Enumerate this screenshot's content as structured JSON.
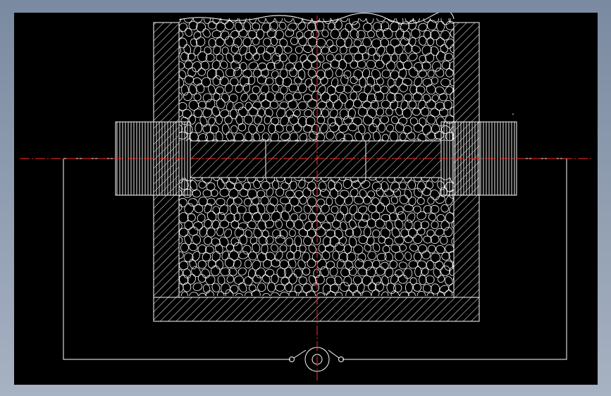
{
  "window": {
    "background_frame_color": "#8a97aa",
    "canvas_color": "#000000"
  },
  "drawing": {
    "type": "CAD cross-section: electrode cell with porous packing and circuit",
    "colors": {
      "line": "#ffffff",
      "center_line": "#ff2a2a"
    },
    "components": [
      "container-wall-left",
      "container-wall-right",
      "container-bottom",
      "porous-bed-upper",
      "porous-bed-lower",
      "electrode-rod",
      "terminal-left",
      "terminal-right",
      "circuit-wire",
      "switch",
      "meter-symbol",
      "center-line-horizontal",
      "center-line-vertical"
    ]
  }
}
